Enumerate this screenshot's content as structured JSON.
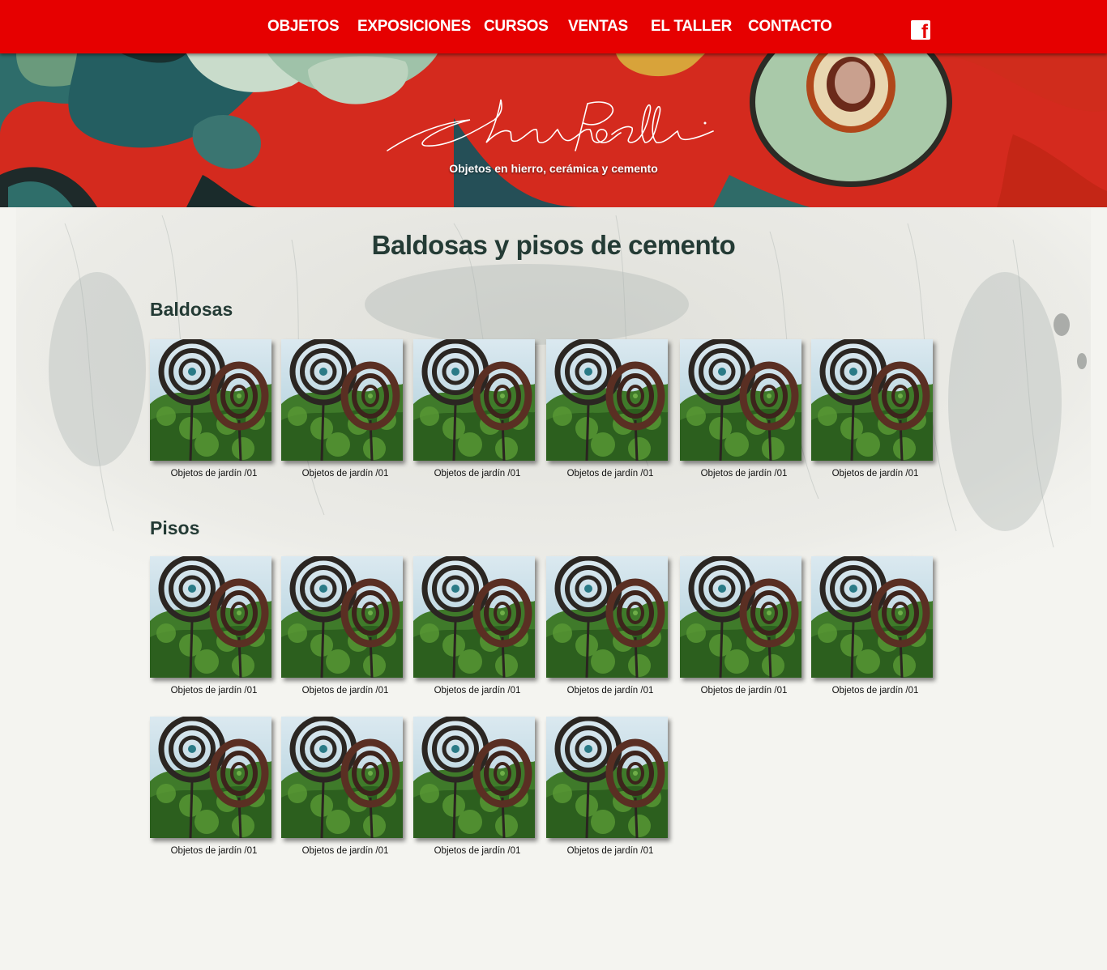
{
  "nav": {
    "items": [
      {
        "label": "OBJETOS"
      },
      {
        "label": "EXPOSICIONES"
      },
      {
        "label": "CURSOS"
      },
      {
        "label": "VENTAS"
      },
      {
        "label": "EL TALLER"
      },
      {
        "label": "CONTACTO"
      }
    ],
    "social_icon": "facebook-icon",
    "social_glyph": "f"
  },
  "hero": {
    "logo_text": "Charo Perelli",
    "tagline": "Objetos en hierro, cerámica y cemento"
  },
  "page": {
    "title": "Baldosas y pisos de cemento"
  },
  "sections": [
    {
      "title": "Baldosas",
      "items": [
        {
          "caption": "Objetos de jardín /01"
        },
        {
          "caption": "Objetos de jardín /01"
        },
        {
          "caption": "Objetos de jardín /01"
        },
        {
          "caption": "Objetos de jardín /01"
        },
        {
          "caption": "Objetos de jardín /01"
        },
        {
          "caption": "Objetos de jardín /01"
        }
      ]
    },
    {
      "title": "Pisos",
      "items": [
        {
          "caption": "Objetos de jardín /01"
        },
        {
          "caption": "Objetos de jardín /01"
        },
        {
          "caption": "Objetos de jardín /01"
        },
        {
          "caption": "Objetos de jardín /01"
        },
        {
          "caption": "Objetos de jardín /01"
        },
        {
          "caption": "Objetos de jardín /01"
        },
        {
          "caption": "Objetos de jardín /01"
        },
        {
          "caption": "Objetos de jardín /01"
        },
        {
          "caption": "Objetos de jardín /01"
        },
        {
          "caption": "Objetos de jardín /01"
        }
      ]
    }
  ],
  "colors": {
    "nav_bg": "#e60000",
    "heading": "#243b35",
    "page_bg": "#f4f4f0"
  }
}
